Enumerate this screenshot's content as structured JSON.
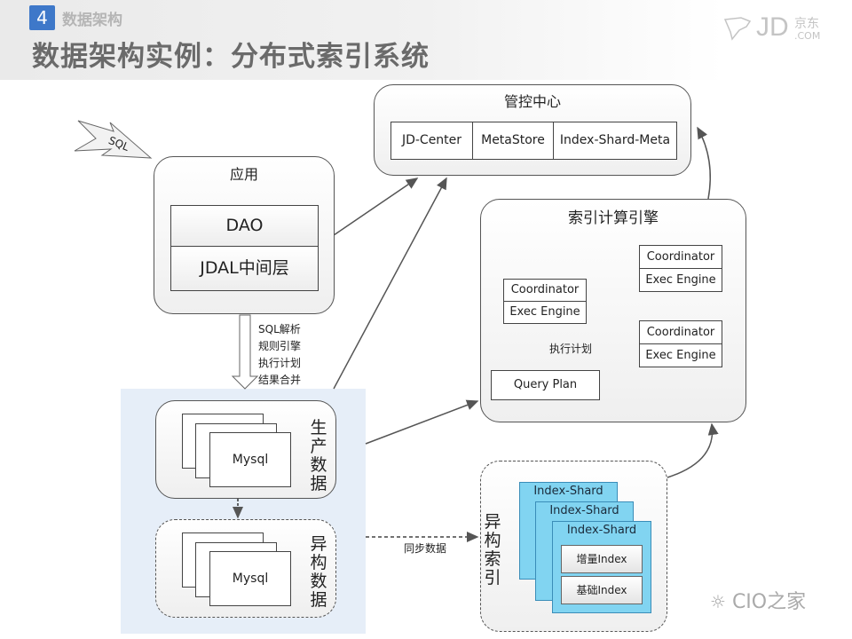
{
  "header": {
    "section_number": "4",
    "section_label": "数据架构",
    "title": "数据架构实例：分布式索引系统",
    "logo": {
      "mark": "JD",
      "cn": "京东",
      "com": ".COM",
      "icon": "jd-bird-icon"
    }
  },
  "control_center": {
    "title": "管控中心",
    "cells": [
      "JD-Center",
      "MetaStore",
      "Index-Shard-Meta"
    ]
  },
  "sql_input": {
    "label": "SQL"
  },
  "application": {
    "title": "应用",
    "layers": [
      "DAO",
      "JDAL中间层"
    ]
  },
  "middleware_steps": [
    "SQL解析",
    "规则引擎",
    "执行计划",
    "结果合并"
  ],
  "compute_engine": {
    "title": "索引计算引擎",
    "nodes": [
      {
        "coordinator": "Coordinator",
        "engine": "Exec Engine"
      },
      {
        "coordinator": "Coordinator",
        "engine": "Exec Engine"
      },
      {
        "coordinator": "Coordinator",
        "engine": "Exec Engine"
      }
    ],
    "plan_label": "执行计划",
    "query_plan": "Query Plan"
  },
  "production_data": {
    "label": [
      "生",
      "产",
      "数",
      "据"
    ],
    "db": "Mysql"
  },
  "heterogeneous_data": {
    "label": [
      "异",
      "构",
      "数",
      "据"
    ],
    "db": "Mysql"
  },
  "sync_label": "同步数据",
  "heterogeneous_index": {
    "label": [
      "异",
      "构",
      "索",
      "引"
    ],
    "shards": [
      "Index-Shard",
      "Index-Shard",
      "Index-Shard"
    ],
    "incremental": "增量Index",
    "base": "基础Index"
  },
  "watermark": "CIO之家",
  "colors": {
    "accent_blue": "#3e78c9",
    "shard_fill": "#81d4f1",
    "data_panel": "#e6eef8"
  }
}
